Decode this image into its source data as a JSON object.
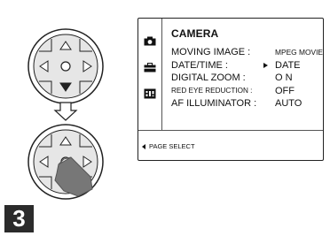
{
  "step_number": "3",
  "menu": {
    "title": "CAMERA",
    "rows": [
      {
        "label": "MOVING IMAGE :",
        "value": "MPEG MOVIE"
      },
      {
        "label": "DATE/TIME :",
        "value": "DATE"
      },
      {
        "label": "DIGITAL ZOOM :",
        "value": "O N"
      },
      {
        "label": "RED EYE REDUCTION :",
        "value": "OFF"
      },
      {
        "label": "AF ILLUMINATOR :",
        "value": "AUTO"
      }
    ],
    "hint": "PAGE SELECT",
    "selected_row": "DATE/TIME :"
  },
  "control_pad": {
    "center_symbol": "O",
    "arrows": [
      "up",
      "down",
      "left",
      "right"
    ]
  },
  "icons": [
    "camera-icon",
    "toolbox-icon",
    "setup-icon",
    "hand-pointer-icon",
    "down-arrow-icon"
  ],
  "colors": {
    "pad_fill": "#e6e6e6",
    "badge": "#2b2b2b",
    "hand": "#777777"
  }
}
